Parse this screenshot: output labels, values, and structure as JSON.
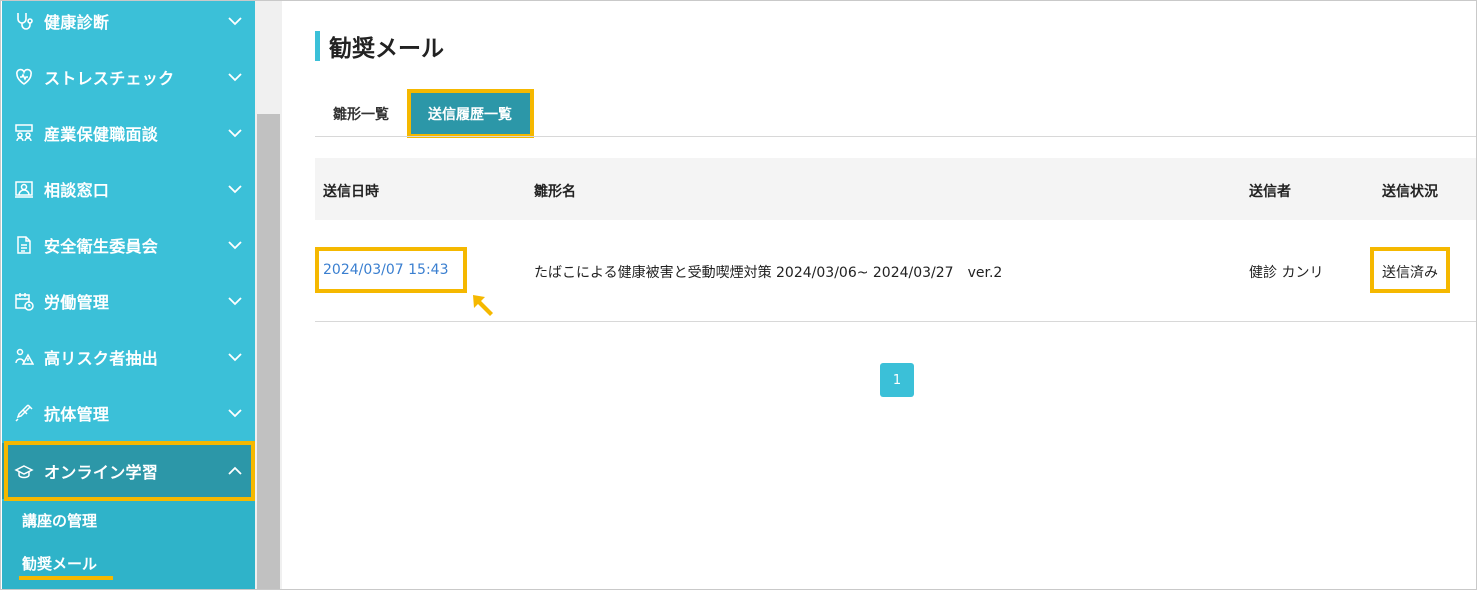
{
  "sidebar": {
    "items": [
      {
        "label": "健康診断",
        "icon": "stethoscope-icon"
      },
      {
        "label": "ストレスチェック",
        "icon": "heart-icon"
      },
      {
        "label": "産業保健職面談",
        "icon": "people-icon"
      },
      {
        "label": "相談窓口",
        "icon": "person-card-icon"
      },
      {
        "label": "安全衛生委員会",
        "icon": "document-icon"
      },
      {
        "label": "労働管理",
        "icon": "calendar-clock-icon"
      },
      {
        "label": "高リスク者抽出",
        "icon": "person-warning-icon"
      },
      {
        "label": "抗体管理",
        "icon": "syringe-icon"
      },
      {
        "label": "オンライン学習",
        "icon": "graduation-cap-icon"
      }
    ],
    "sub_items": [
      {
        "label": "講座の管理"
      },
      {
        "label": "勧奨メール"
      }
    ]
  },
  "page": {
    "title": "勧奨メール"
  },
  "tabs": [
    {
      "label": "雛形一覧"
    },
    {
      "label": "送信履歴一覧"
    }
  ],
  "table": {
    "headers": [
      "送信日時",
      "雛形名",
      "送信者",
      "送信状況"
    ],
    "rows": [
      {
        "datetime": "2024/03/07 15:43",
        "template": "たばこによる健康被害と受動喫煙対策 2024/03/06~ 2024/03/27　ver.2",
        "sender": "健診 カンリ",
        "status": "送信済み"
      }
    ]
  },
  "pagination": {
    "current": "1"
  },
  "colors": {
    "sidebar": "#3bc0d8",
    "active": "#2c97a8",
    "highlight": "#f5b800",
    "link": "#3a7fd0"
  }
}
